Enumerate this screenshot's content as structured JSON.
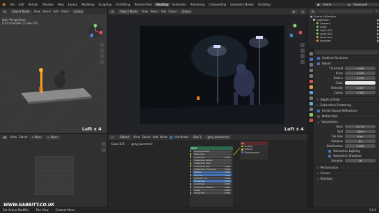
{
  "top_menu": [
    "File",
    "Edit",
    "Render",
    "Window",
    "Help"
  ],
  "workspaces": [
    "Layout",
    "Modeling",
    "Sculpting",
    "UV Editing",
    "Texture Paint",
    "Shading",
    "Animation",
    "Rendering",
    "Compositing",
    "Geometry Nodes",
    "Scripting"
  ],
  "active_workspace": "Shading",
  "scene_name": "Scene",
  "view_layer": "ViewLayer",
  "left_viewport": {
    "mode": "Object Mode",
    "menus": [
      "View",
      "Select",
      "Add",
      "Object"
    ],
    "orientation": "Global",
    "title": "User Perspective",
    "subtitle": "(142) monster | Cube.025",
    "view_label": "Left x 4"
  },
  "main_viewport": {
    "mode": "Object Mode",
    "menus": [
      "View",
      "Select",
      "Add",
      "Object"
    ],
    "orientation": "Global",
    "options_label": "Options",
    "view_label": "Left x 4"
  },
  "file_browser": {
    "menus": [
      "View",
      "Select"
    ],
    "new_button": "New",
    "open_button": "Open"
  },
  "node_editor": {
    "header_items": [
      "Object",
      "View",
      "Select",
      "Add",
      "Node"
    ],
    "use_nodes": "Use Nodes",
    "slot": "Slot 1",
    "material": "grey pavement",
    "object": "Cube.025",
    "material2": "grey pavement",
    "output_node": {
      "title": "All",
      "sockets": [
        "Surface",
        "Volume",
        "Displacement"
      ]
    },
    "bsdf_node": {
      "title": "BSDF",
      "rows": [
        {
          "label": "Principled BSDF"
        },
        {
          "label": "Base Color"
        },
        {
          "label": "Subsurface",
          "value": "0.000"
        },
        {
          "label": "Subsurface Radius"
        },
        {
          "label": "Subsurface Color"
        },
        {
          "label": "Subsurface IOR",
          "value": "1.400"
        },
        {
          "label": "Subsurface Anisotropy",
          "value": "0.000"
        },
        {
          "label": "Metallic",
          "value": "0.000"
        },
        {
          "label": "Specular",
          "value": "0.500"
        },
        {
          "label": "Specular Tint",
          "value": "0.000"
        },
        {
          "label": "Roughness",
          "value": "0.500"
        },
        {
          "label": "Anisotropic",
          "value": "0.000"
        },
        {
          "label": "Anisotropic Rotation",
          "value": "0.000"
        },
        {
          "label": "Sheen",
          "value": "0.000"
        },
        {
          "label": "Sheen Tint",
          "value": "0.500"
        }
      ]
    }
  },
  "outliner": {
    "title": "Scene Collection",
    "items": [
      {
        "label": "Collection",
        "color": "#cfcfcf"
      },
      {
        "label": "Camera",
        "color": "#86c96a"
      },
      {
        "label": "Light",
        "color": "#86c96a"
      },
      {
        "label": "Light.001",
        "color": "#86c96a"
      },
      {
        "label": "Light.002",
        "color": "#86c96a"
      },
      {
        "label": "lamp.box",
        "color": "#e4a04c"
      },
      {
        "label": "monster",
        "color": "#e4a04c"
      }
    ]
  },
  "properties": {
    "ambient_occlusion": "Ambient Occlusion",
    "bloom": "Bloom",
    "bloom_fields": [
      {
        "label": "Threshold",
        "value": "0.800"
      },
      {
        "label": "Knee",
        "value": "0.500"
      },
      {
        "label": "Radius",
        "value": "6.500"
      },
      {
        "label": "Color",
        "value": ""
      },
      {
        "label": "Intensity",
        "value": "0.007"
      },
      {
        "label": "Clamp",
        "value": "0.000"
      }
    ],
    "depth_of_field": "Depth of Field",
    "subsurface": "Subsurface Scattering",
    "ssr": "Screen Space Reflections",
    "motion_blur": "Motion Blur",
    "volumetrics": "Volumetrics",
    "volumetrics_fields": [
      {
        "label": "Start",
        "value": "0.1 m"
      },
      {
        "label": "End",
        "value": "100 m"
      },
      {
        "label": "Tile Size",
        "value": "4 px"
      },
      {
        "label": "Samples",
        "value": "64"
      },
      {
        "label": "Distribution",
        "value": "0.800"
      }
    ],
    "vol_lighting": "Volumetric Lighting",
    "vol_shadows": "Volumetric Shadows",
    "vol_samples_label": "Samples",
    "vol_samples_value": "16",
    "performance": "Performance",
    "curves": "Curves",
    "shadows": "Shadows"
  },
  "status_bar": {
    "items": [
      "Set Active Modifier",
      "Pan View",
      "Context Menu"
    ],
    "watermark": "WWW.GABBITT.CO.UK",
    "version": "3.0.0"
  },
  "colors": {
    "accent": "#4772b3",
    "active_tab": "#545454",
    "viewport_bg": "#393939",
    "render_bg": "#0d1015"
  }
}
